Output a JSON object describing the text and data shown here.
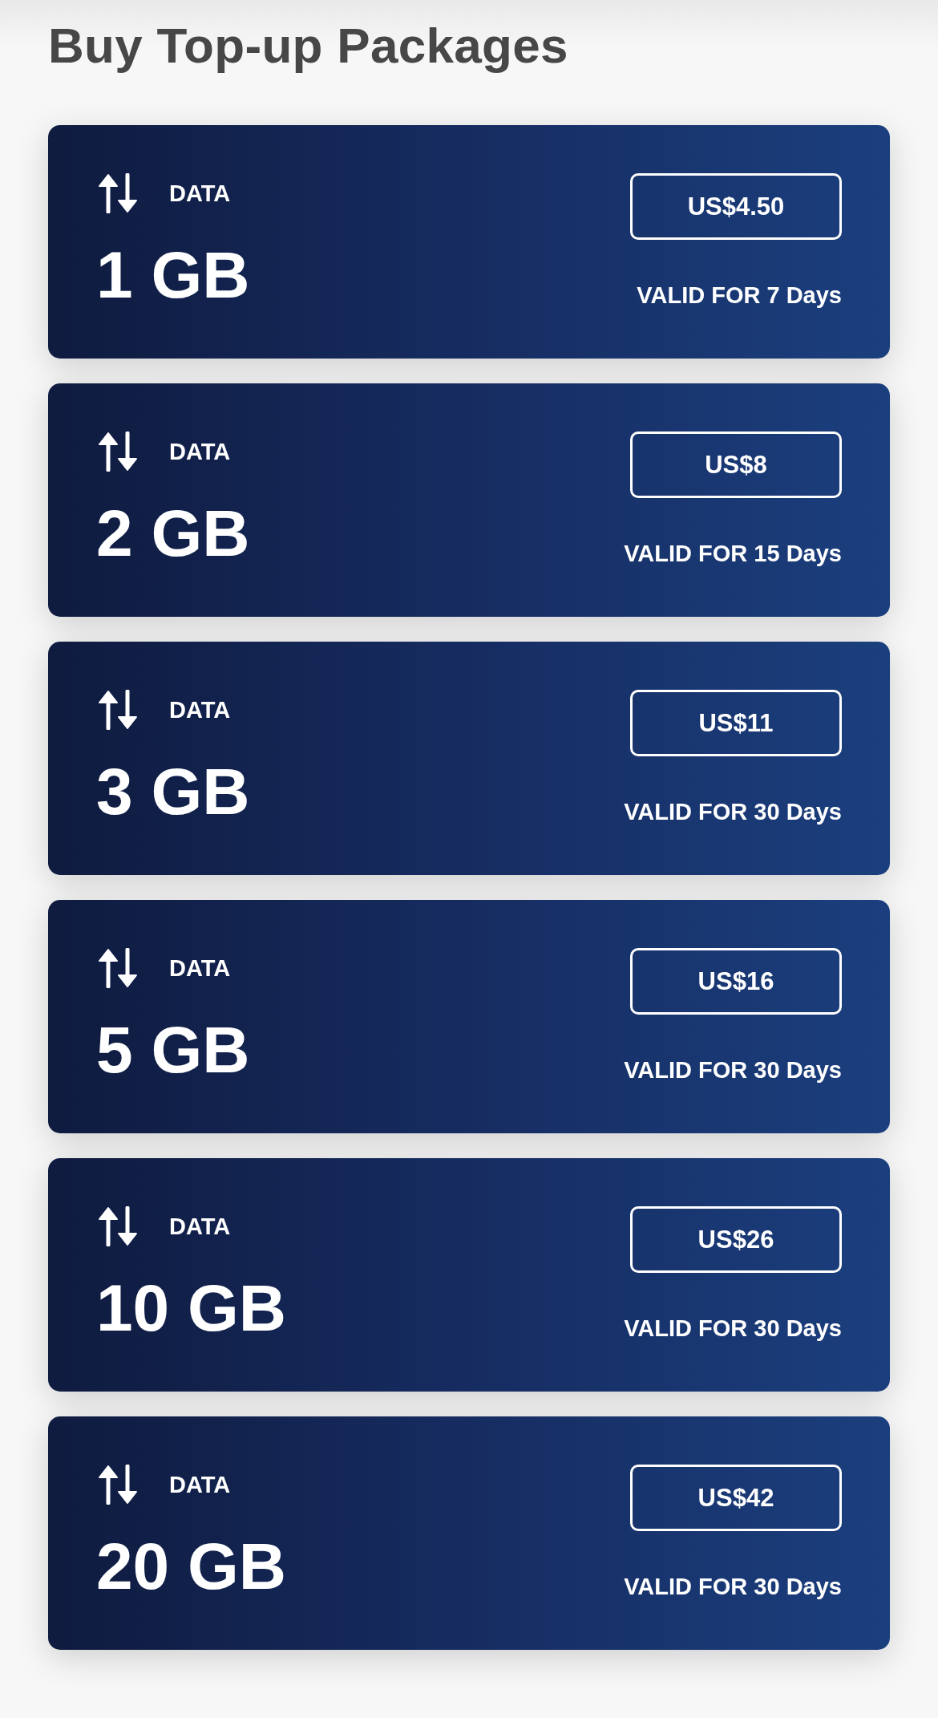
{
  "title": "Buy Top-up Packages",
  "packages": [
    {
      "label": "DATA",
      "amount": "1 GB",
      "price": "US$4.50",
      "validity": "VALID FOR 7 Days"
    },
    {
      "label": "DATA",
      "amount": "2 GB",
      "price": "US$8",
      "validity": "VALID FOR 15 Days"
    },
    {
      "label": "DATA",
      "amount": "3 GB",
      "price": "US$11",
      "validity": "VALID FOR 30 Days"
    },
    {
      "label": "DATA",
      "amount": "5 GB",
      "price": "US$16",
      "validity": "VALID FOR 30 Days"
    },
    {
      "label": "DATA",
      "amount": "10 GB",
      "price": "US$26",
      "validity": "VALID FOR 30 Days"
    },
    {
      "label": "DATA",
      "amount": "20 GB",
      "price": "US$42",
      "validity": "VALID FOR 30 Days"
    }
  ]
}
